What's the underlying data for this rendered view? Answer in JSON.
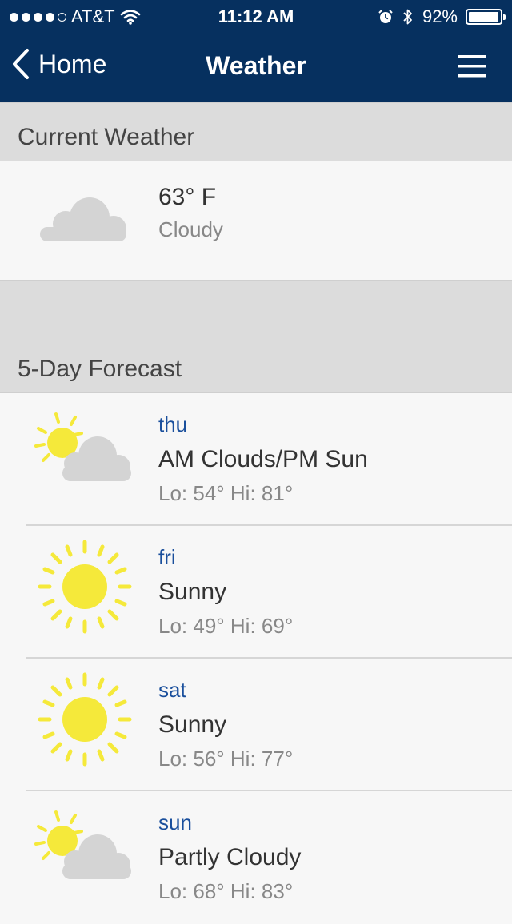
{
  "status_bar": {
    "carrier": "AT&T",
    "time": "11:12 AM",
    "battery": "92%"
  },
  "nav": {
    "back_label": "Home",
    "title": "Weather"
  },
  "current": {
    "header": "Current Weather",
    "temperature": "63° F",
    "condition": "Cloudy",
    "icon": "cloud-icon"
  },
  "forecast": {
    "header": "5-Day Forecast",
    "days": [
      {
        "day": "thu",
        "condition": "AM Clouds/PM Sun",
        "lohi": "Lo: 54° Hi: 81°",
        "icon": "partly-cloudy-icon"
      },
      {
        "day": "fri",
        "condition": "Sunny",
        "lohi": "Lo: 49° Hi: 69°",
        "icon": "sun-icon"
      },
      {
        "day": "sat",
        "condition": "Sunny",
        "lohi": "Lo: 56° Hi: 77°",
        "icon": "sun-icon"
      },
      {
        "day": "sun",
        "condition": "Partly Cloudy",
        "lohi": "Lo: 68° Hi: 83°",
        "icon": "partly-cloudy-icon"
      }
    ]
  },
  "colors": {
    "nav_bg": "#06305f",
    "day_text": "#1a4f9c",
    "sun": "#f5e93a",
    "cloud": "#d4d4d4"
  }
}
